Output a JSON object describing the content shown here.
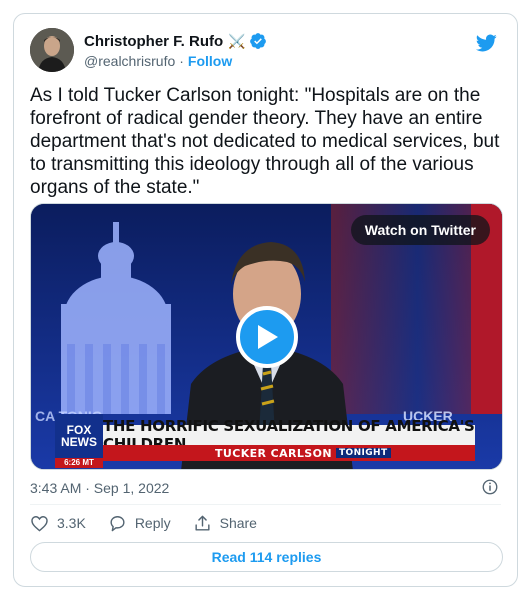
{
  "author": {
    "display_name": "Christopher F. Rufo",
    "emoji": "⚔️",
    "handle": "@realchrisrufo",
    "separator": "·",
    "follow_label": "Follow"
  },
  "tweet": {
    "text": "As I told Tucker Carlson tonight: \"Hospitals are on the forefront of radical gender theory. They have an entire department that's not dedicated to medical services, but to transmitting this ideology through all of the various organs of the state.\""
  },
  "media": {
    "watch_label": "Watch on Twitter",
    "headline": "THE HORRIFIC SEXUALIZATION OF AMERICA'S CHILDREN",
    "show_name": "TUCKER CARLSON",
    "show_suffix": "TONIGHT",
    "network_top": "FOX",
    "network_bottom": "NEWS",
    "channel_time": "6:26 MT",
    "background_left": "CA   TONIG",
    "background_right": "UCKER CARLSON"
  },
  "meta": {
    "timestamp": "3:43 AM · Sep 1, 2022"
  },
  "actions": {
    "likes": "3.3K",
    "reply_label": "Reply",
    "share_label": "Share",
    "read_replies": "Read 114 replies"
  },
  "colors": {
    "accent": "#1d9bf0",
    "text": "#0f1419",
    "secondary": "#536471",
    "border": "#cfd9de"
  }
}
